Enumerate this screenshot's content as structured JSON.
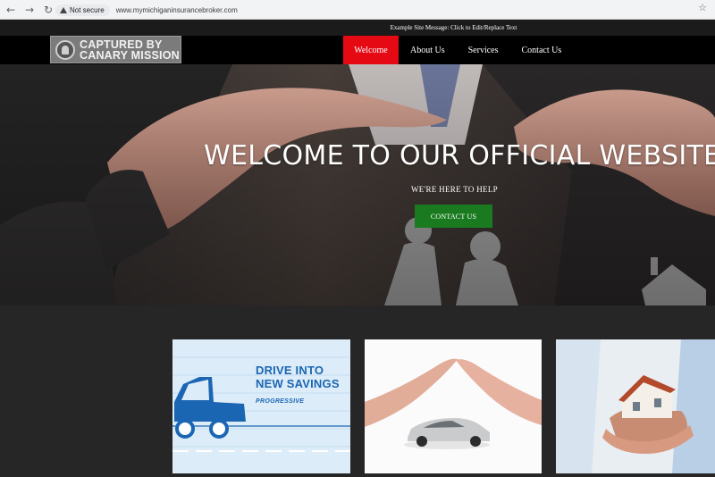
{
  "browser": {
    "security_label": "Not secure",
    "url": "www.mymichiganinsurancebroker.com",
    "icons": [
      "back-arrow-icon",
      "forward-arrow-icon",
      "reload-icon",
      "warning-icon",
      "star-icon"
    ]
  },
  "site_message": "Example Site Message: Click to Edit/Replace Text",
  "watermark": {
    "line1": "CAPTURED BY",
    "line2": "CANARY MISSION"
  },
  "nav": {
    "items": [
      {
        "label": "Welcome",
        "active": true
      },
      {
        "label": "About Us",
        "active": false
      },
      {
        "label": "Services",
        "active": false
      },
      {
        "label": "Contact Us",
        "active": false
      }
    ],
    "active_color": "#e50914"
  },
  "hero": {
    "title": "WELCOME TO OUR OFFICIAL WEBSITE",
    "subtitle": "WE'RE HERE TO HELP",
    "cta_label": "CONTACT US",
    "cta_color": "#197a1f"
  },
  "cards": [
    {
      "headline_line1": "DRIVE INTO",
      "headline_line2": "NEW SAVINGS",
      "brand": "PROGRESSIVE",
      "accent": "#1b66b3"
    },
    {
      "subject": "car-protected-by-hands"
    },
    {
      "subject": "house-held-in-hands"
    }
  ]
}
